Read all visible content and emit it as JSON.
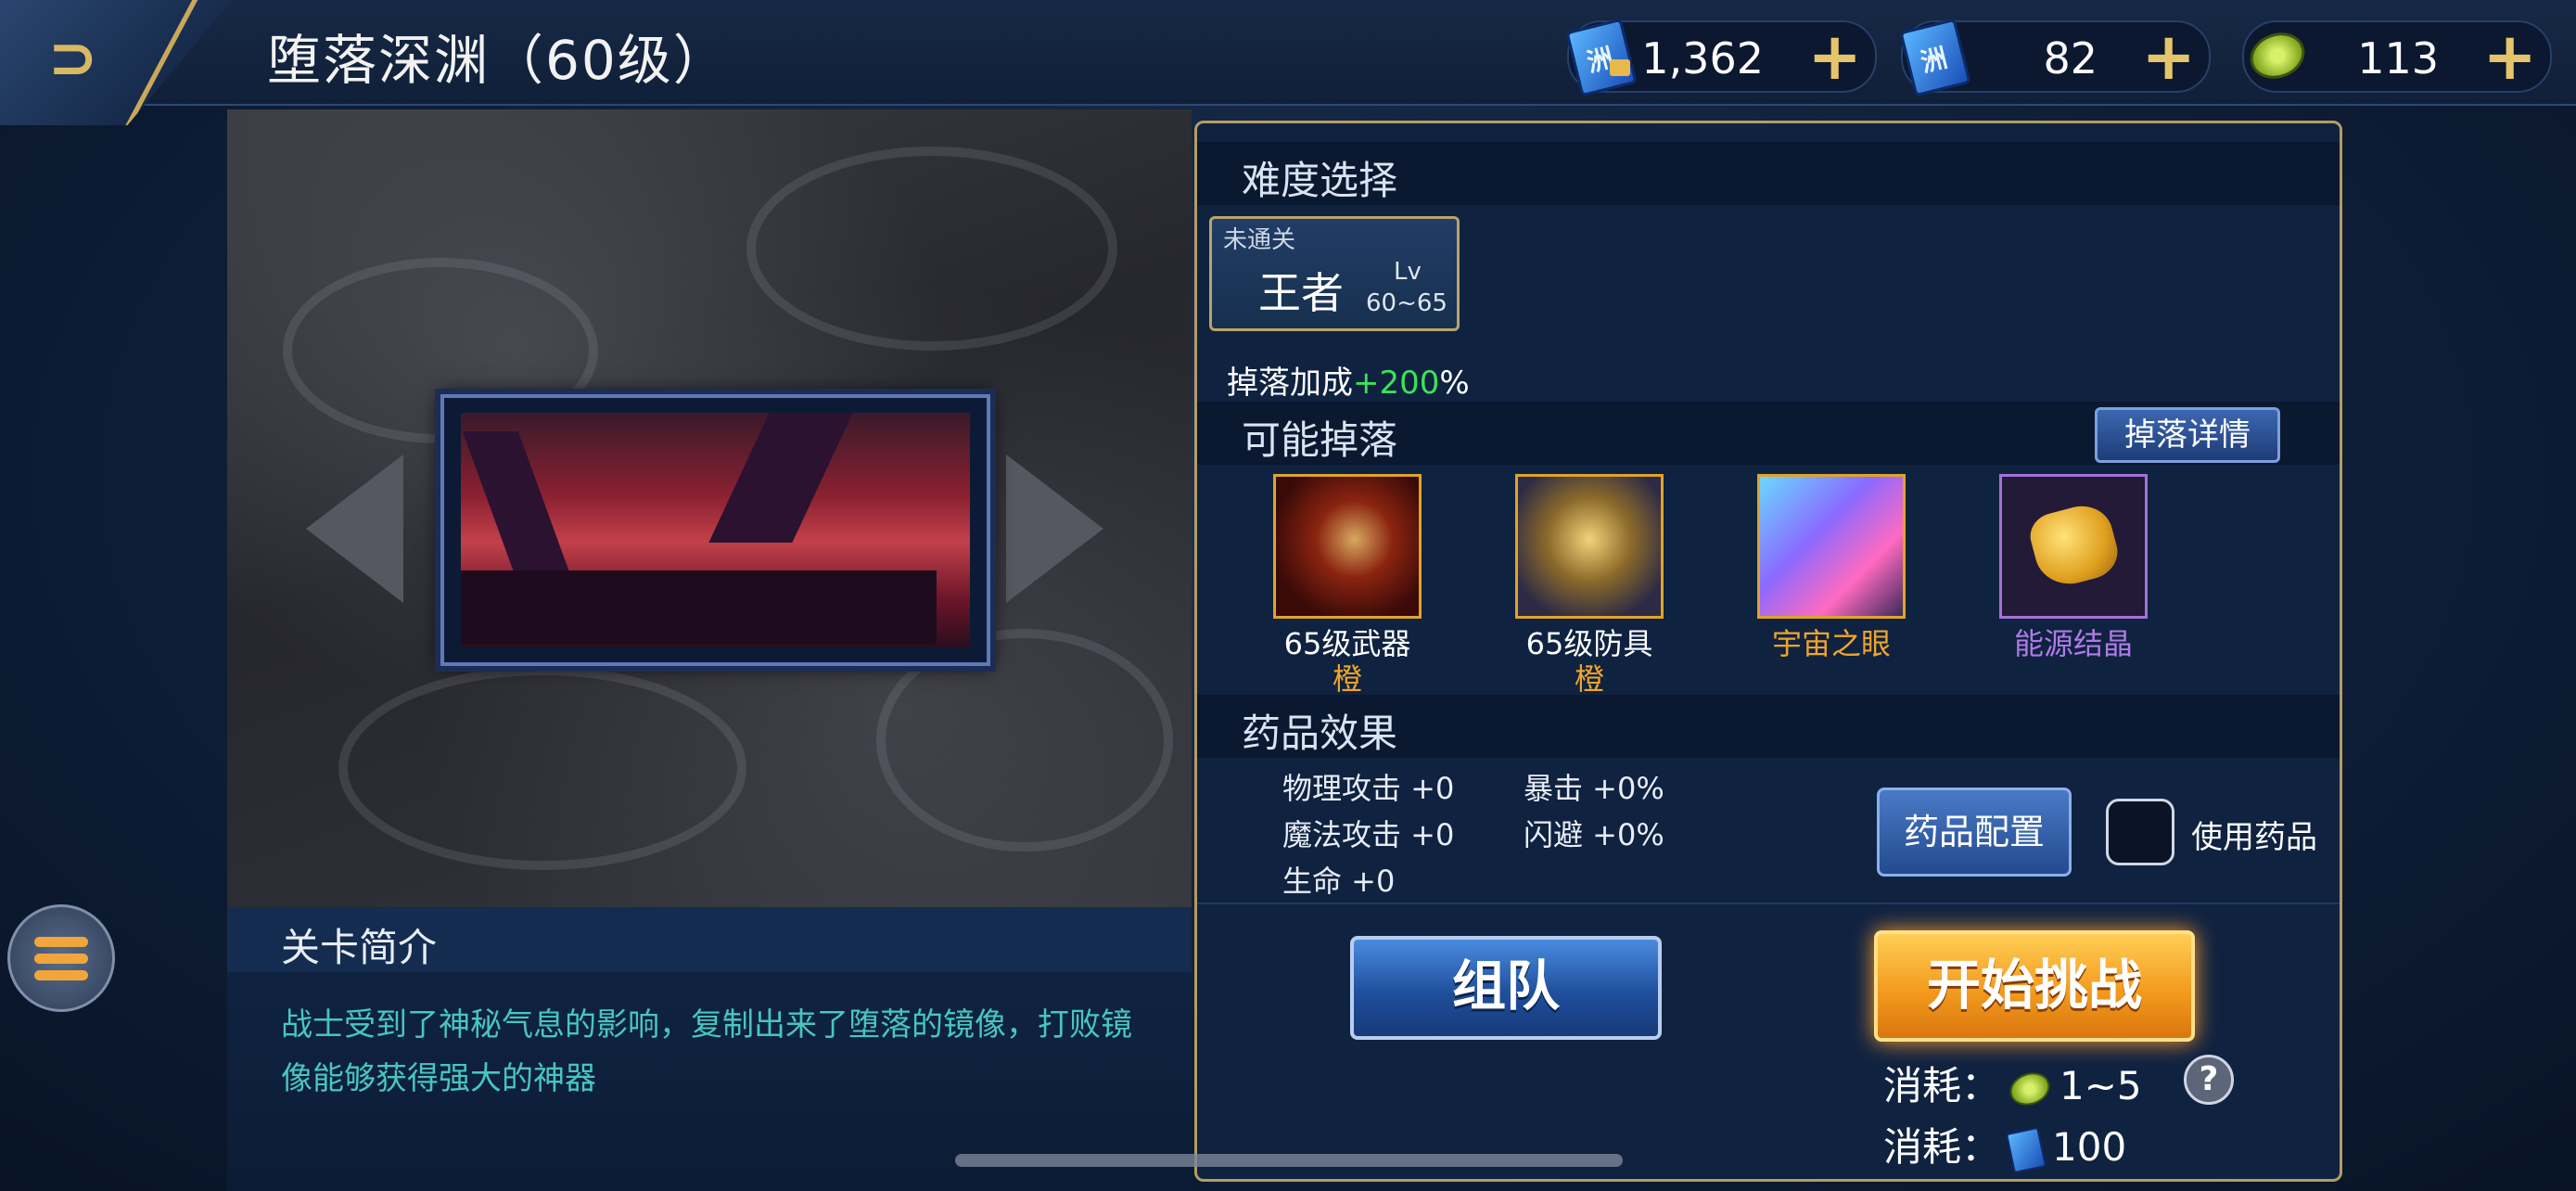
{
  "header": {
    "title": "堕落深渊（60级）"
  },
  "currencies": [
    {
      "icon": "locked-ticket-icon",
      "value": "1,362"
    },
    {
      "icon": "ticket-icon",
      "value": "82"
    },
    {
      "icon": "coin-icon",
      "value": "113"
    }
  ],
  "intro": {
    "heading": "关卡简介",
    "description": "战士受到了神秘气息的影响，复制出来了堕落的镜像，打败镜像能够获得强大的神器"
  },
  "difficulty": {
    "heading": "难度选择",
    "card": {
      "status": "未通关",
      "name": "王者",
      "lv_label": "Lv",
      "range": "60~65"
    },
    "bonus_label": "掉落加成",
    "bonus_value": "+200",
    "bonus_suffix": "%"
  },
  "drops": {
    "heading": "可能掉落",
    "details_button": "掉落详情",
    "items": [
      {
        "name": "65级武器",
        "quality": "橙",
        "icon": "weapon-icon"
      },
      {
        "name": "65级防具",
        "quality": "橙",
        "icon": "armor-icon"
      },
      {
        "name": "宇宙之眼",
        "quality": "",
        "icon": "crystal-icon"
      },
      {
        "name": "能源结晶",
        "quality": "",
        "icon": "energy-crystal-icon"
      }
    ]
  },
  "medicine": {
    "heading": "药品效果",
    "stats": [
      "物理攻击 +0",
      "暴击 +0%",
      "魔法攻击 +0",
      "闪避 +0%",
      "生命 +0"
    ],
    "config_button": "药品配置",
    "use_label": "使用药品"
  },
  "actions": {
    "team_button": "组队",
    "start_button": "开始挑战",
    "cost_label": "消耗：",
    "cost_coin": "1~5",
    "cost_ticket": "100",
    "help": "?"
  },
  "colors": {
    "accent_gold": "#b49c62",
    "bonus_green": "#3ce25a",
    "orange_quality": "#f0a52a",
    "purple_quality": "#a372d8",
    "intro_text": "#47c6c0"
  }
}
